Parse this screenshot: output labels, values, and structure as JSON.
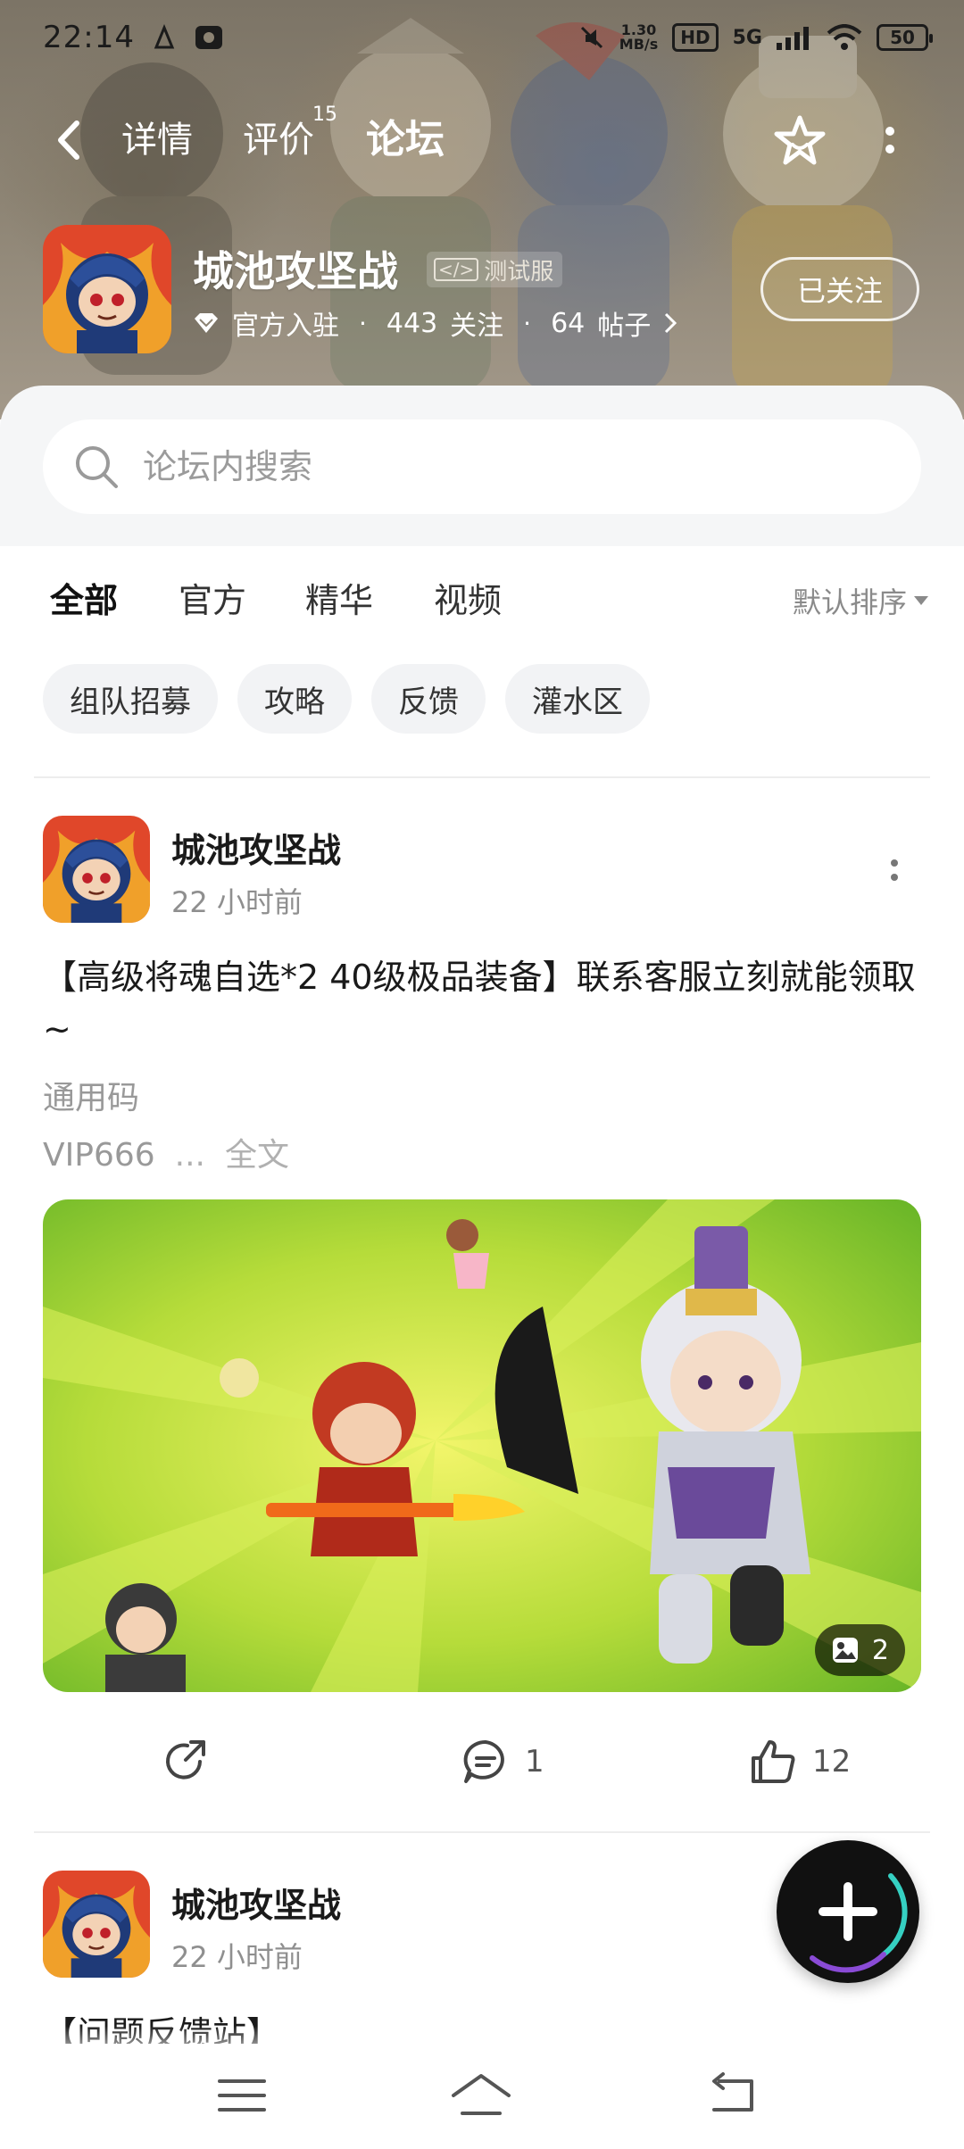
{
  "status_bar": {
    "time": "22:14",
    "net_speed_value": "1.30",
    "net_speed_unit": "MB/s",
    "hd_label": "HD",
    "signal_label": "5G",
    "battery": "50"
  },
  "nav": {
    "tabs": [
      {
        "label": "详情"
      },
      {
        "label": "评价",
        "badge": "15"
      },
      {
        "label": "论坛",
        "active": true
      }
    ]
  },
  "game": {
    "title": "城池攻坚战",
    "tag": "测试服",
    "tag_code": "</>",
    "official": "官方入驻",
    "follow_count": "443",
    "follow_label": "关注",
    "post_count": "64",
    "post_label": "帖子",
    "follow_button": "已关注"
  },
  "search": {
    "placeholder": "论坛内搜索"
  },
  "category_tabs": [
    {
      "label": "全部",
      "active": true
    },
    {
      "label": "官方"
    },
    {
      "label": "精华"
    },
    {
      "label": "视频"
    }
  ],
  "sort": {
    "label": "默认排序"
  },
  "chips": [
    "组队招募",
    "攻略",
    "反馈",
    "灌水区"
  ],
  "posts": [
    {
      "author": "城池攻坚战",
      "time": "22 小时前",
      "title": "【高级将魂自选*2 40级极品装备】联系客服立刻就能领取~",
      "body_lines": [
        "通用码",
        "VIP666"
      ],
      "ellipsis": "...",
      "full_text": "全文",
      "image_count": "2",
      "comments": "1",
      "likes": "12"
    },
    {
      "author": "城池攻坚战",
      "time": "22 小时前",
      "title": "【问题反馈站】"
    }
  ],
  "colors": {
    "accent": "#2ed3c2",
    "hero_bg": "#8c8373",
    "text_secondary": "#8f8f8f"
  }
}
